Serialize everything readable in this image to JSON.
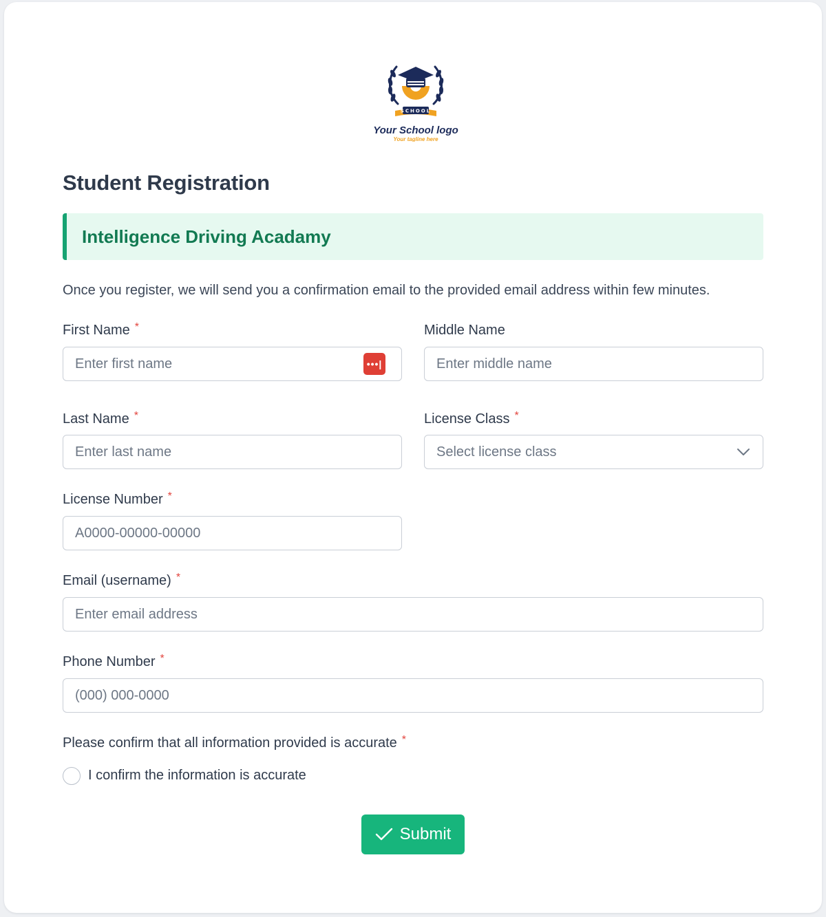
{
  "logo": {
    "name": "Your School logo",
    "tagline": "Your tagline here",
    "badge_text": "SCHOOL"
  },
  "title": "Student Registration",
  "banner": "Intelligence Driving Acadamy",
  "intro": "Once you register, we will send you a confirmation email to the provided email address within few minutes.",
  "required_mark": "*",
  "fields": {
    "first_name": {
      "label": "First Name",
      "placeholder": "Enter first name"
    },
    "middle_name": {
      "label": "Middle Name",
      "placeholder": "Enter middle name"
    },
    "last_name": {
      "label": "Last Name",
      "placeholder": "Enter last name"
    },
    "license_class": {
      "label": "License Class",
      "placeholder": "Select license class"
    },
    "license_number": {
      "label": "License Number",
      "placeholder": "A0000-00000-00000"
    },
    "email": {
      "label": "Email (username)",
      "placeholder": "Enter email address"
    },
    "phone": {
      "label": "Phone Number",
      "placeholder": "(000) 000-0000"
    }
  },
  "confirm": {
    "question": "Please confirm that all information provided is accurate",
    "option": "I confirm the information is accurate"
  },
  "submit_label": "Submit",
  "password_manager_icon": "dots-icon",
  "colors": {
    "accent": "#17b57c",
    "banner_bg": "#e6f9f0",
    "banner_text": "#127a52",
    "required": "#e2453e"
  }
}
